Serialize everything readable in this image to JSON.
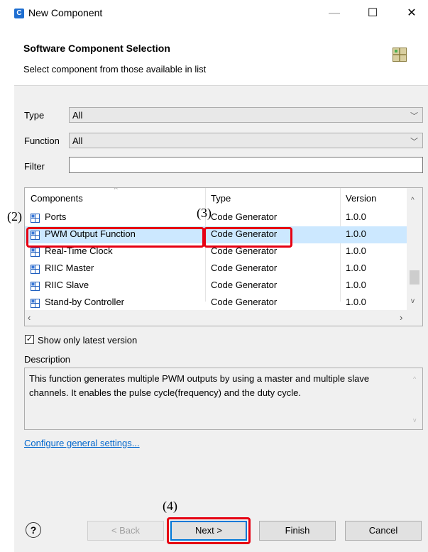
{
  "window": {
    "title": "New Component",
    "app_icon_text": "C",
    "minimize_glyph": "—",
    "maximize_glyph": "☐",
    "close_glyph": "✕"
  },
  "header": {
    "title": "Software Component Selection",
    "description": "Select component from those available in list"
  },
  "filters": {
    "type_label": "Type",
    "type_value": "All",
    "function_label": "Function",
    "function_value": "All",
    "filter_label": "Filter",
    "filter_value": ""
  },
  "table": {
    "columns": [
      "Components",
      "Type",
      "Version"
    ],
    "rows": [
      {
        "component": "Ports",
        "type": "Code Generator",
        "version": "1.0.0"
      },
      {
        "component": "PWM Output Function",
        "type": "Code Generator",
        "version": "1.0.0"
      },
      {
        "component": "Real-Time Clock",
        "type": "Code Generator",
        "version": "1.0.0"
      },
      {
        "component": "RIIC Master",
        "type": "Code Generator",
        "version": "1.0.0"
      },
      {
        "component": "RIIC Slave",
        "type": "Code Generator",
        "version": "1.0.0"
      },
      {
        "component": "Stand-by Controller",
        "type": "Code Generator",
        "version": "1.0.0"
      }
    ],
    "selected_index": 1
  },
  "show_latest": {
    "label": "Show only latest version",
    "checked": true
  },
  "description": {
    "label": "Description",
    "text": "This function generates multiple PWM outputs by using a master and multiple slave channels. It enables the pulse cycle(frequency) and the duty cycle."
  },
  "configure_link": "Configure general settings...",
  "buttons": {
    "help": "?",
    "back": "< Back",
    "next": "Next >",
    "finish": "Finish",
    "cancel": "Cancel"
  },
  "annotations": {
    "step2": "(2)",
    "step3": "(3)",
    "step4": "(4)"
  },
  "colors": {
    "accent": "#0078d7",
    "selection": "#cce8ff",
    "annotation_red": "#e60012",
    "link": "#0066cc"
  }
}
